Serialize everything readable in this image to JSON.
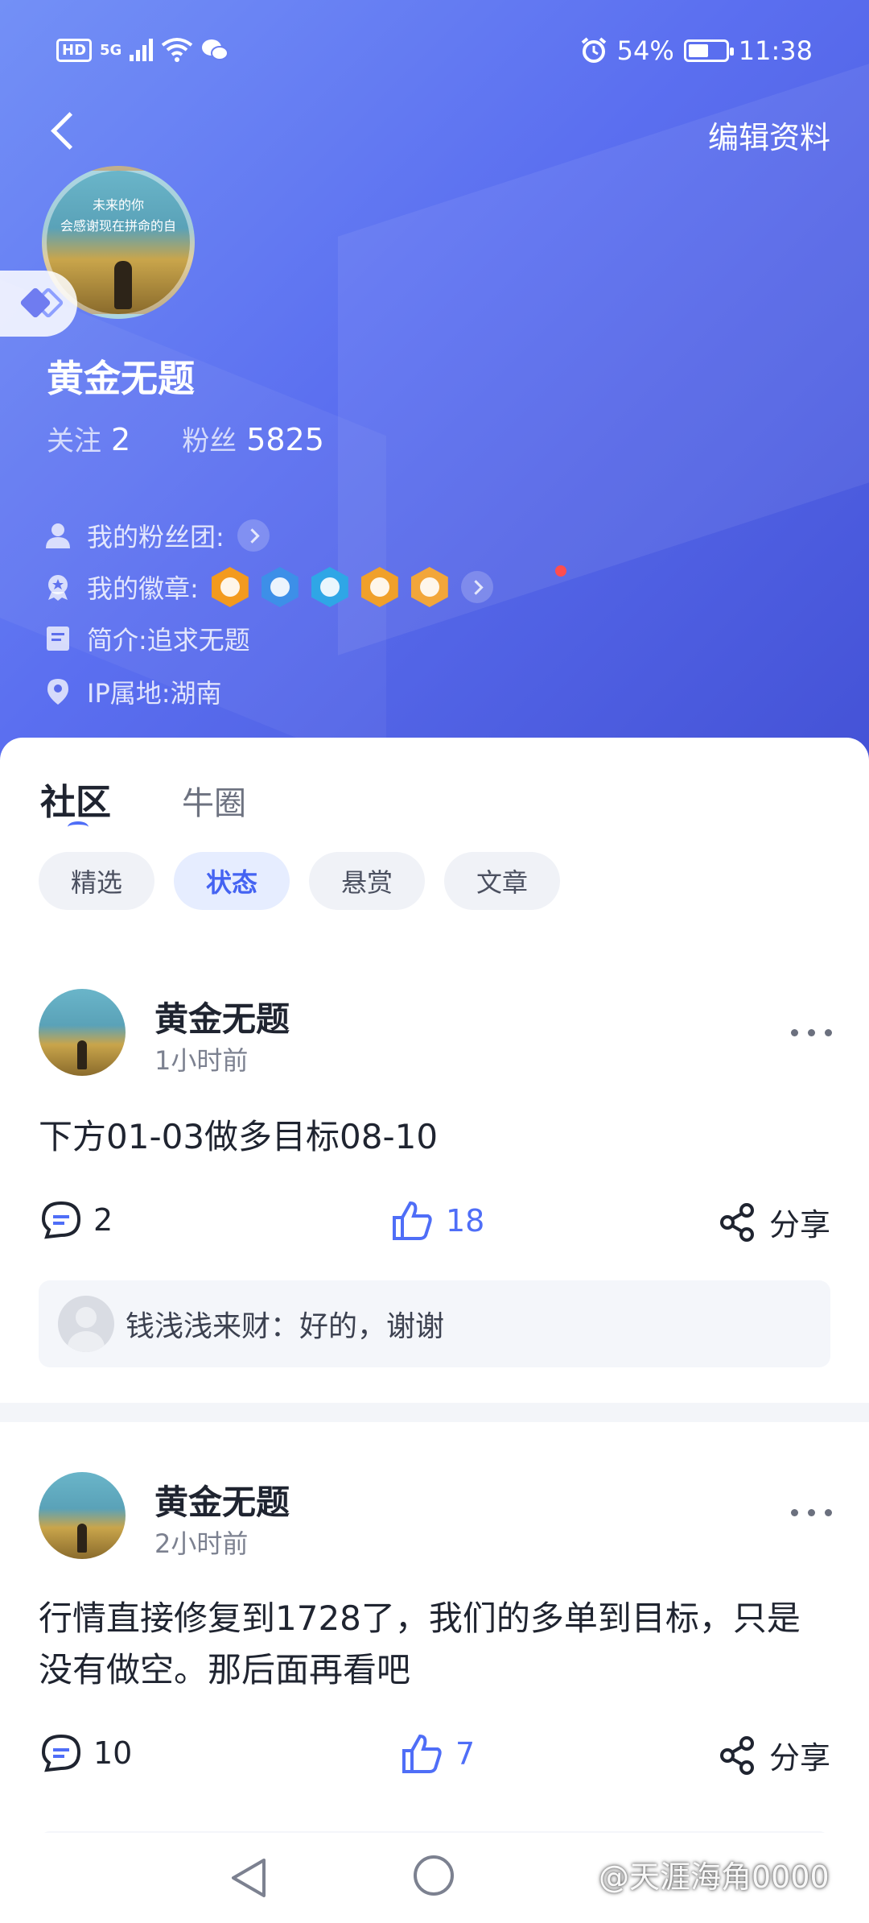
{
  "status_bar": {
    "hd": "HD",
    "network": "5G",
    "battery_percent": "54%",
    "battery_level": 0.54,
    "time": "11:38"
  },
  "header": {
    "edit_label": "编辑资料",
    "avatar_text_line1": "未来的你",
    "avatar_text_line2": "会感谢现在拼命的自",
    "name": "黄金无题",
    "following_label": "关注",
    "following_count": "2",
    "fans_label": "粉丝",
    "fans_count": "5825",
    "fan_club_label": "我的粉丝团:",
    "badges_label": "我的徽章:",
    "intro_label": "简介:",
    "intro_value": "追求无题",
    "ip_label": "IP属地:",
    "ip_value": "湖南",
    "badge_colors": [
      "#f39a1e",
      "#3d8fe8",
      "#2fa6e6",
      "#f0a02a",
      "#f2a63a"
    ]
  },
  "tabs": [
    {
      "label": "社区",
      "active": true
    },
    {
      "label": "牛圈",
      "active": false
    }
  ],
  "chips": [
    {
      "label": "精选",
      "active": false
    },
    {
      "label": "状态",
      "active": true
    },
    {
      "label": "悬赏",
      "active": false
    },
    {
      "label": "文章",
      "active": false
    }
  ],
  "posts": [
    {
      "author": "黄金无题",
      "time": "1小时前",
      "content": "下方01-03做多目标08-10",
      "comments": "2",
      "likes": "18",
      "share_label": "分享",
      "reply_user": "钱浅浅来财",
      "reply_text": "：好的，谢谢"
    },
    {
      "author": "黄金无题",
      "time": "2小时前",
      "content": "行情直接修复到1728了，我们的多单到目标，只是没有做空。那后面再看吧",
      "comments": "10",
      "likes": "7",
      "share_label": "分享"
    }
  ],
  "watermark": "@天涯海角0000",
  "colors": {
    "header_start": "#7390f6",
    "header_end": "#4452d6",
    "accent": "#4f6ef7",
    "notification": "#ff4d4f"
  }
}
